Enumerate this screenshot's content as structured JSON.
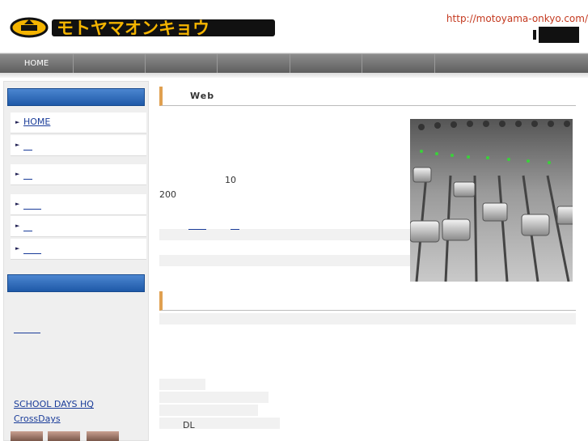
{
  "header": {
    "logo_text": "モトヤマオンキョウ",
    "site_url": "http://motoyama-onkyo.com/"
  },
  "nav": {
    "items": [
      {
        "label": "HOME"
      },
      {
        "label": ""
      },
      {
        "label": ""
      },
      {
        "label": ""
      },
      {
        "label": ""
      },
      {
        "label": ""
      }
    ]
  },
  "sidebar": {
    "menu": [
      {
        "label": "HOME"
      },
      {
        "label": "　"
      },
      {
        "label": "　"
      },
      {
        "label": "　　"
      },
      {
        "label": "　"
      },
      {
        "label": "　　"
      }
    ],
    "link_1": "　　　",
    "works": [
      {
        "label": "SCHOOL DAYS HQ"
      },
      {
        "label": "CrossDays"
      }
    ]
  },
  "main": {
    "section1_title": "Web",
    "num_10": "10",
    "num_200": "200",
    "link_a": "　　",
    "link_b": "　",
    "dl_text": "DL"
  },
  "colors": {
    "url_text": "#c4391f",
    "link": "#1a3c99",
    "sidebar_header": "#1f59a8",
    "section_accent": "#e0a050"
  }
}
